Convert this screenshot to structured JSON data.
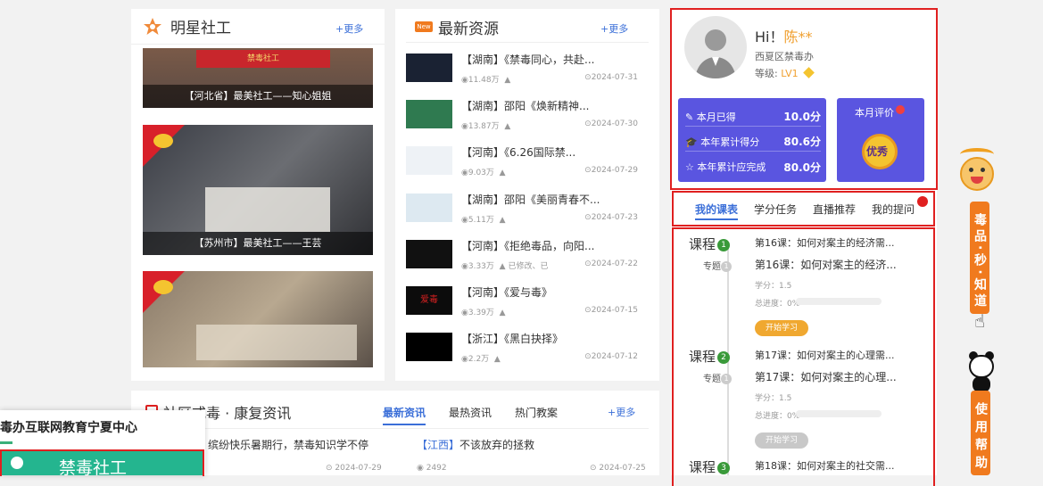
{
  "stars": {
    "title": "明星社工",
    "more": "+更多",
    "items": [
      {
        "caption": "【河北省】最美社工——知心姐姐",
        "banner": "禁毒社工"
      },
      {
        "caption": "【苏州市】最美社工——王芸"
      },
      {
        "caption": ""
      }
    ]
  },
  "resources": {
    "title": "最新资源",
    "new_badge": "New",
    "more": "+更多",
    "items": [
      {
        "title": "【湖南】《禁毒同心，共赴...",
        "views": "11.48万",
        "author": "",
        "date": "2024-07-31",
        "thumb": "#1a2233"
      },
      {
        "title": "【湖南】邵阳《焕新精神...",
        "views": "13.87万",
        "author": "",
        "date": "2024-07-30",
        "thumb": "#2f7a50"
      },
      {
        "title": "【河南】《6.26国际禁...",
        "views": "9.03万",
        "author": "",
        "date": "2024-07-29",
        "thumb": "#eef2f6"
      },
      {
        "title": "【湖南】邵阳《美丽青春不...",
        "views": "5.11万",
        "author": "",
        "date": "2024-07-23",
        "thumb": "#dde9f1"
      },
      {
        "title": "【河南】《拒绝毒品，向阳...",
        "views": "3.33万",
        "author": "已修改、已",
        "date": "2024-07-22",
        "thumb": "#111111"
      },
      {
        "title": "【河南】《爱与毒》",
        "views": "3.39万",
        "author": "",
        "date": "2024-07-15",
        "thumb": "#0c0c0c",
        "thumb_text": "爱毒"
      },
      {
        "title": "【浙江】《黑白抉择》",
        "views": "2.2万",
        "author": "",
        "date": "2024-07-12",
        "thumb": "#000000"
      }
    ]
  },
  "profile": {
    "greeting": "Hi！",
    "name": "陈**",
    "org": "西夏区禁毒办",
    "level_label": "等级:",
    "level": "LV1"
  },
  "stats": {
    "month_label": "本月已得",
    "month_value": "10.0分",
    "year_label": "本年累计得分",
    "year_value": "80.6分",
    "complete_label": "本年累计应完成",
    "complete_value": "80.0分",
    "eval_label": "本月评价",
    "eval_badge": "优秀"
  },
  "tabs": [
    "我的课表",
    "学分任务",
    "直播推荐",
    "我的提问"
  ],
  "courses": [
    {
      "label": "课程",
      "num": "1",
      "sub": "专题",
      "sub_num": "1",
      "line1": "第16课：如何对案主的经济需...",
      "line2": "第16课：如何对案主的经济...",
      "credit": "学分：1.5",
      "progress_label": "总进度：",
      "progress": "0%",
      "btn": "开始学习",
      "btn_color": "#f0a830"
    },
    {
      "label": "课程",
      "num": "2",
      "sub": "专题",
      "sub_num": "1",
      "line1": "第17课：如何对案主的心理需...",
      "line2": "第17课：如何对案主的心理...",
      "credit": "学分：1.5",
      "progress_label": "总进度：",
      "progress": "0%",
      "btn": "开始学习",
      "btn_color": "#c8c8c8"
    },
    {
      "label": "课程",
      "num": "3",
      "line1": "第18课：如何对案主的社交需..."
    }
  ],
  "news": {
    "title": "社区戒毒 · 康复资讯",
    "tabs": [
      "最新资讯",
      "最热资讯",
      "热门教案"
    ],
    "more": "+更多",
    "left_item": "缤纷快乐暑期行，禁毒知识学不停",
    "left_date": "2024-07-29",
    "right_tag": "【江西】",
    "right_item": "不该放弃的拯救",
    "right_views": "2492",
    "right_date": "2024-07-25"
  },
  "popup": {
    "title": "毒办互联网教育宁夏中心",
    "button": "禁毒社工"
  },
  "side": {
    "mascot1_text": "毒品·秒·知道",
    "mascot2_text": "使用帮助"
  }
}
